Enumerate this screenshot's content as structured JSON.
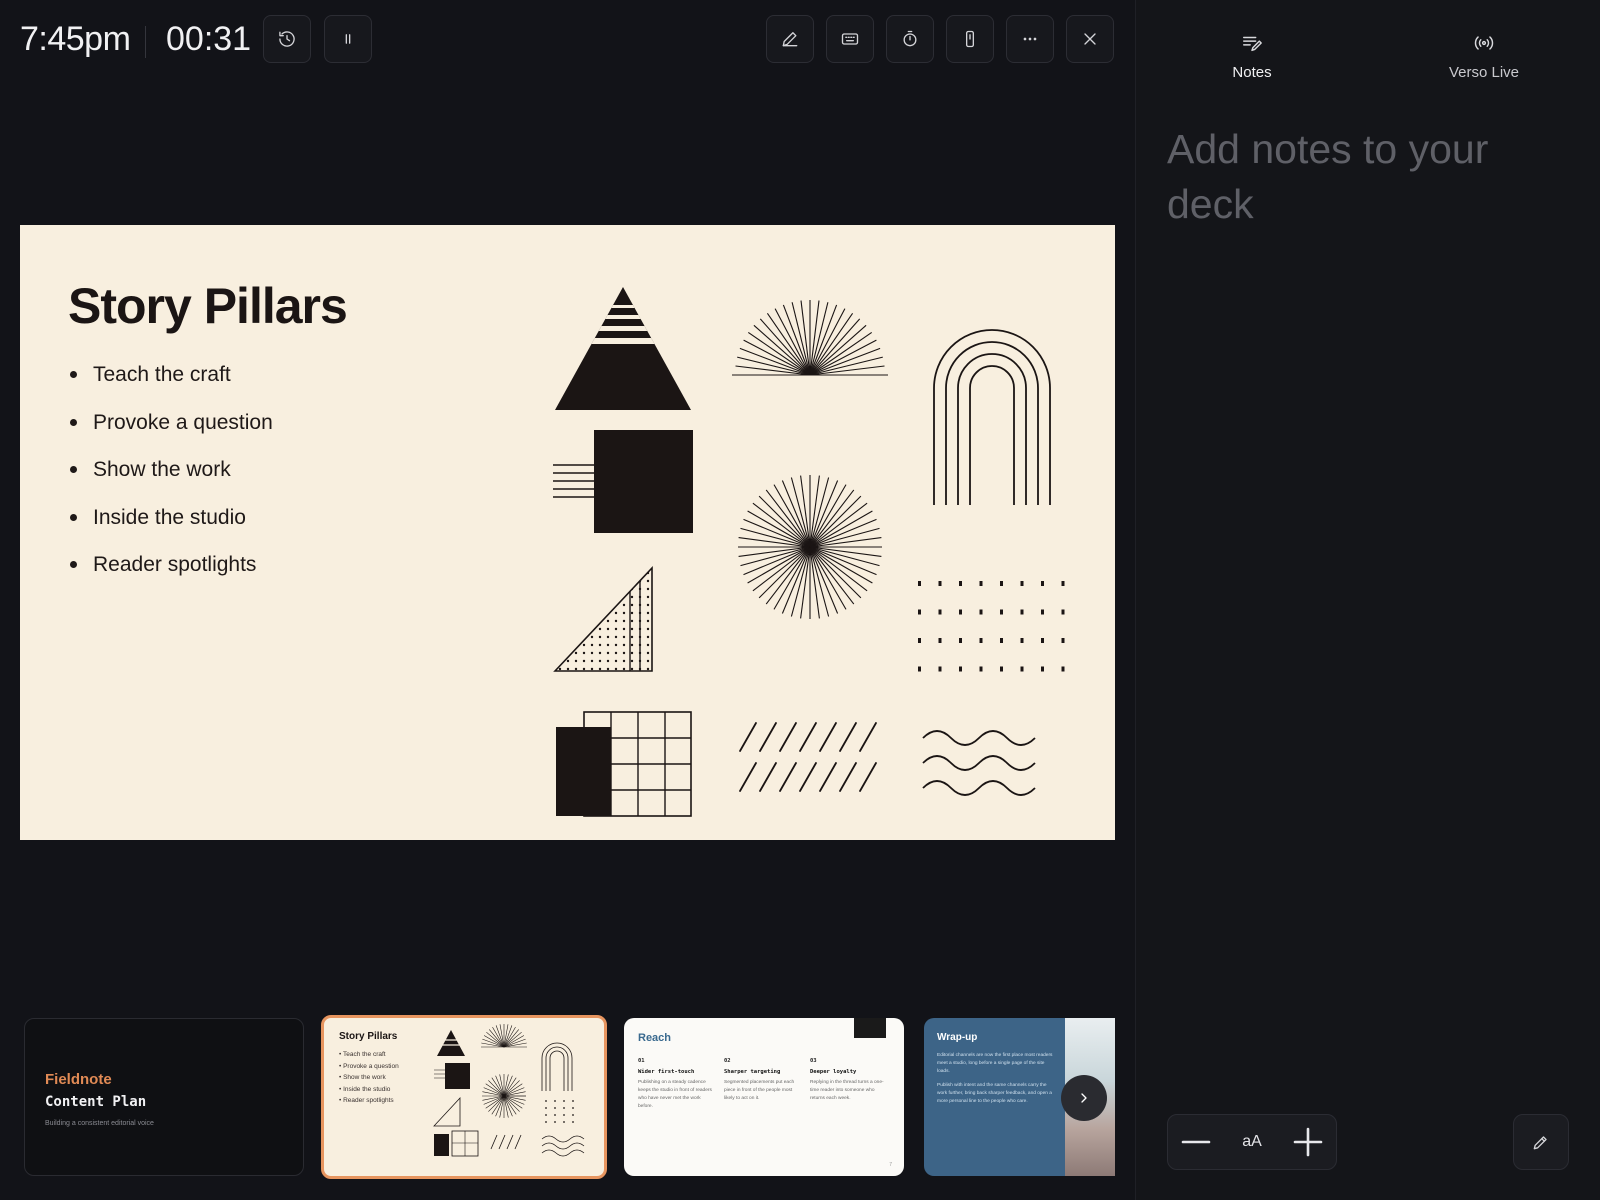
{
  "topbar": {
    "clock": "7:45pm",
    "elapsed": "00:31",
    "buttons": {
      "history": "history-icon",
      "pause": "pause-icon",
      "pen": "pen-icon",
      "keyboard": "keyboard-icon",
      "timer": "timer-icon",
      "phone": "phone-icon",
      "more": "more-icon",
      "close": "close-icon"
    }
  },
  "slide": {
    "title": "Story Pillars",
    "bullets": [
      "Teach the craft",
      "Provoke a question",
      "Show the work",
      "Inside the studio",
      "Reader spotlights"
    ],
    "background": "#f8efdf",
    "ink": "#1b1514"
  },
  "thumbnails": [
    {
      "brand": "Fieldnote",
      "subtitle": "Content Plan",
      "tagline": "Building a consistent editorial voice"
    },
    {
      "title": "Story Pillars",
      "bullets": [
        "• Teach the craft",
        "• Provoke a question",
        "• Show the work",
        "• Inside the studio",
        "• Reader spotlights"
      ],
      "selected": true
    },
    {
      "title": "Reach",
      "columns": [
        {
          "num": "01",
          "head": "Wider first-touch",
          "body": "Publishing on a steady cadence keeps the studio in front of readers who have never met the work before."
        },
        {
          "num": "02",
          "head": "Sharper targeting",
          "body": "Segmented placements put each piece in front of the people most likely to act on it."
        },
        {
          "num": "03",
          "head": "Deeper loyalty",
          "body": "Replying in the thread turns a one-time reader into someone who returns each week."
        }
      ],
      "page": "7"
    },
    {
      "title": "Wrap-up",
      "body1": "Editorial channels are now the first place most readers meet a studio, long before a single page of the site loads.",
      "body2": "Publish with intent and the same channels carry the work further, bring back sharper feedback, and open a more personal line to the people who care."
    }
  ],
  "right_panel": {
    "tabs": [
      {
        "label": "Notes",
        "icon": "notes-icon",
        "active": true
      },
      {
        "label": "Verso Live",
        "icon": "broadcast-icon",
        "active": false
      }
    ],
    "notes_placeholder": "Add notes to your deck",
    "zoom": {
      "decrease": "minus-icon",
      "font_size_label": "aA",
      "increase": "plus-icon"
    },
    "edit": "pencil-icon"
  },
  "colors": {
    "background": "#121318",
    "panel": "#141519",
    "accent": "#e7955f",
    "reach_title": "#3a6a8f",
    "wrapup_bg": "#3d6487"
  }
}
